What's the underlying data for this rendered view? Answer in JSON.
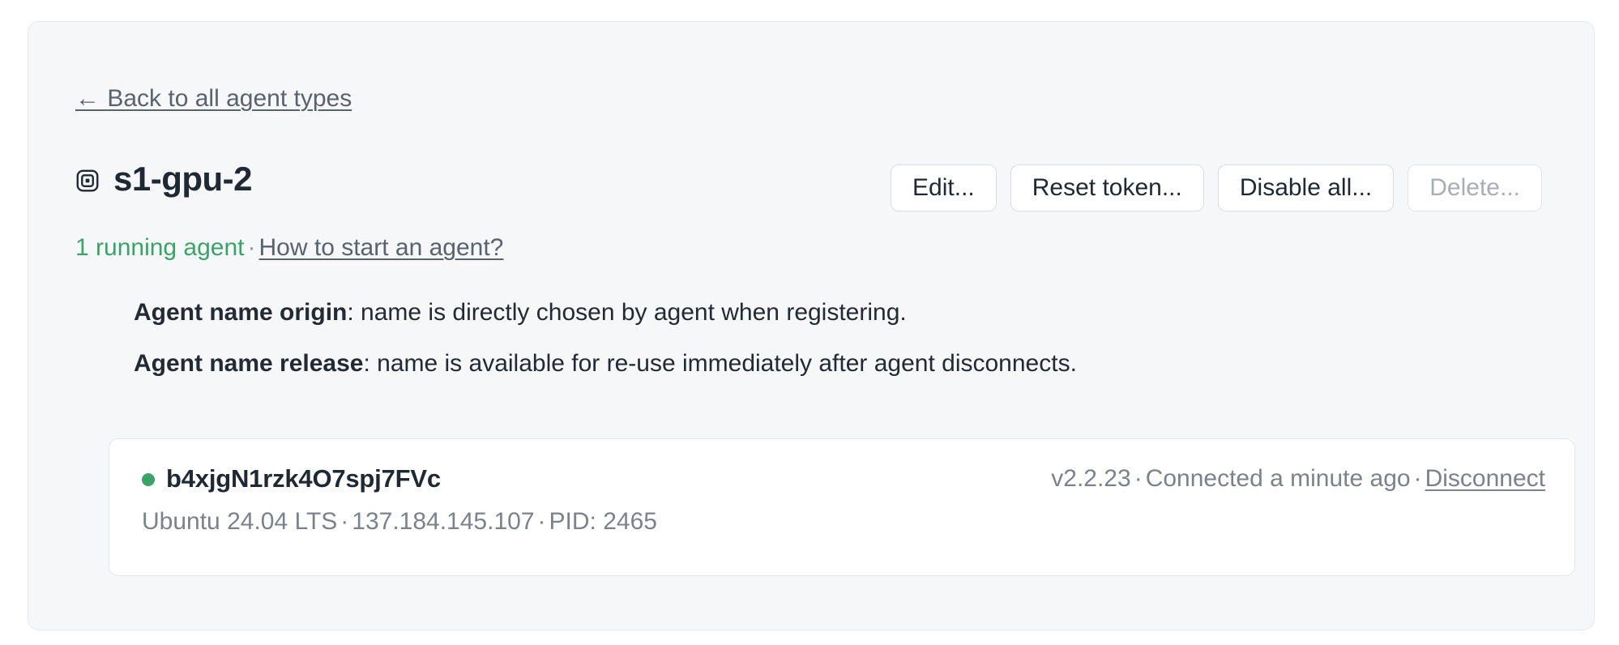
{
  "back_link": {
    "arrow": "←",
    "label": "Back to all agent types"
  },
  "header": {
    "icon_name": "agent-type-box-icon",
    "title": "s1-gpu-2"
  },
  "actions": {
    "edit_label": "Edit...",
    "reset_token_label": "Reset token...",
    "disable_all_label": "Disable all...",
    "delete_label": "Delete..."
  },
  "status": {
    "running_text": "1 running agent",
    "separator": "·",
    "help_link": "How to start an agent?",
    "running_color": "#3aa468"
  },
  "details": [
    {
      "term": "Agent name origin",
      "description": ": name is directly chosen by agent when registering."
    },
    {
      "term": "Agent name release",
      "description": ": name is available for re-use immediately after agent disconnects."
    }
  ],
  "agents": [
    {
      "status_dot_color": "#3aa468",
      "id": "b4xjgN1rzk4O7spj7FVc",
      "version": "v2.2.23",
      "connected": "Connected a minute ago",
      "disconnect_label": "Disconnect",
      "os": "Ubuntu 24.04 LTS",
      "ip": "137.184.145.107",
      "pid": "PID: 2465",
      "separator": "·"
    }
  ]
}
